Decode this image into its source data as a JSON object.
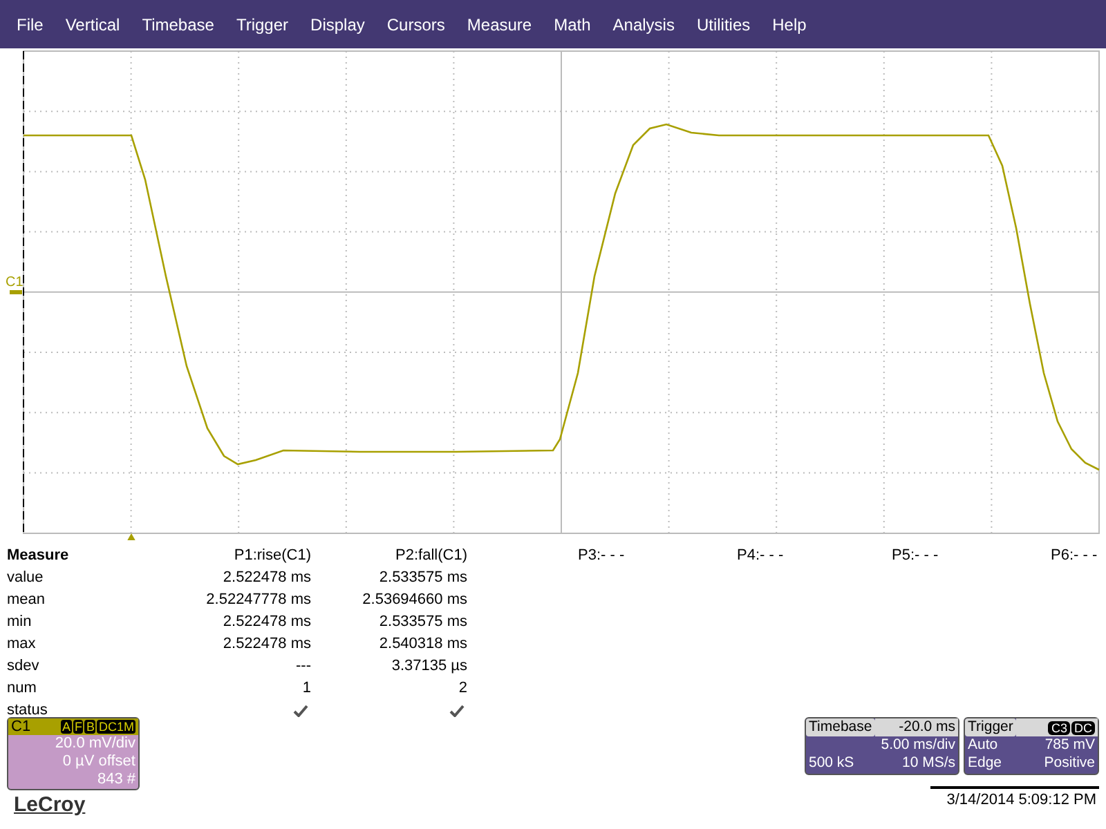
{
  "menu": [
    "File",
    "Vertical",
    "Timebase",
    "Trigger",
    "Display",
    "Cursors",
    "Measure",
    "Math",
    "Analysis",
    "Utilities",
    "Help"
  ],
  "grid": {
    "channel_marker": "C1"
  },
  "measure": {
    "title": "Measure",
    "params": [
      "P1:rise(C1)",
      "P2:fall(C1)",
      "P3:- - -",
      "P4:- - -",
      "P5:- - -",
      "P6:- - -"
    ],
    "rows": [
      {
        "label": "value",
        "cells": [
          {
            "kind": "text",
            "text": "2.522478 ms"
          },
          {
            "kind": "text",
            "text": "2.533575 ms"
          }
        ]
      },
      {
        "label": "mean",
        "cells": [
          {
            "kind": "text",
            "text": "2.52247778 ms"
          },
          {
            "kind": "text",
            "text": "2.53694660 ms"
          }
        ]
      },
      {
        "label": "min",
        "cells": [
          {
            "kind": "text",
            "text": "2.522478 ms"
          },
          {
            "kind": "text",
            "text": "2.533575 ms"
          }
        ]
      },
      {
        "label": "max",
        "cells": [
          {
            "kind": "text",
            "text": "2.522478 ms"
          },
          {
            "kind": "text",
            "text": "2.540318 ms"
          }
        ]
      },
      {
        "label": "sdev",
        "cells": [
          {
            "kind": "text",
            "text": "---"
          },
          {
            "kind": "text",
            "text": "3.37135 µs"
          }
        ]
      },
      {
        "label": "num",
        "cells": [
          {
            "kind": "text",
            "text": "1"
          },
          {
            "kind": "text",
            "text": "2"
          }
        ]
      },
      {
        "label": "status",
        "cells": [
          {
            "kind": "check"
          },
          {
            "kind": "check"
          }
        ]
      }
    ]
  },
  "channel": {
    "name": "C1",
    "badges": [
      "A",
      "F",
      "B",
      "DC1M"
    ],
    "lines": [
      "20.0 mV/div",
      "0 µV offset",
      "843 #"
    ]
  },
  "logo": "LeCroy",
  "timebase": {
    "title": "Timebase",
    "delay": "-20.0 ms",
    "per_div": "5.00 ms/div",
    "samples": "500 kS",
    "rate": "10 MS/s"
  },
  "trigger": {
    "title": "Trigger",
    "badges": [
      "C3",
      "DC"
    ],
    "mode": "Auto",
    "level": "785 mV",
    "type": "Edge",
    "slope": "Positive"
  },
  "timestamp": "3/14/2014 5:09:12 PM"
}
